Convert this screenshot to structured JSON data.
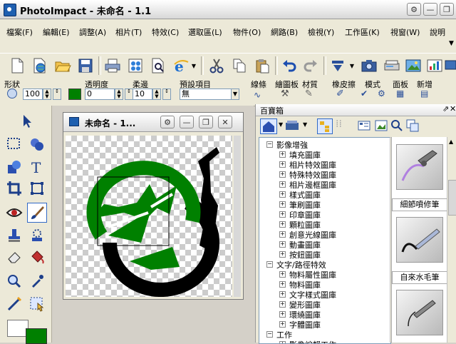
{
  "window": {
    "title": "PhotoImpact - 未命名 - 1.1"
  },
  "menu": [
    {
      "label": "檔案(F)"
    },
    {
      "label": "編輯(E)"
    },
    {
      "label": "調整(A)"
    },
    {
      "label": "相片(T)"
    },
    {
      "label": "特效(C)"
    },
    {
      "label": "選取區(L)"
    },
    {
      "label": "物件(O)"
    },
    {
      "label": "網路(B)"
    },
    {
      "label": "檢視(Y)"
    },
    {
      "label": "工作區(K)"
    },
    {
      "label": "視窗(W)"
    },
    {
      "label": "說明"
    }
  ],
  "attr": {
    "shape_label": "形狀",
    "size_value": "100",
    "opacity_label": "透明度",
    "opacity_value": "0",
    "soft_label": "柔邊",
    "soft_value": "10",
    "preset_label": "預設項目",
    "preset_value": "無",
    "line_label": "線條",
    "paint_label": "繪圖板",
    "material_label": "材質",
    "eraser_label": "橡皮擦",
    "mode_label": "模式",
    "panel_label": "面板",
    "new_label": "新增",
    "brush_color": "#008000"
  },
  "document": {
    "title": "未命名 - 1..."
  },
  "panel": {
    "title": "百寶箱",
    "tree": [
      {
        "label": "影像增強",
        "level": 1,
        "expanded": true
      },
      {
        "label": "填充圖庫",
        "level": 2
      },
      {
        "label": "相片特效圖庫",
        "level": 2
      },
      {
        "label": "特殊特效圖庫",
        "level": 2
      },
      {
        "label": "相片邊框圖庫",
        "level": 2
      },
      {
        "label": "樣式圖庫",
        "level": 2
      },
      {
        "label": "筆刷圖庫",
        "level": 2
      },
      {
        "label": "印章圖庫",
        "level": 2
      },
      {
        "label": "顆粒圖庫",
        "level": 2
      },
      {
        "label": "創意光線圖庫",
        "level": 2
      },
      {
        "label": "動畫圖庫",
        "level": 2
      },
      {
        "label": "按鈕圖庫",
        "level": 2
      },
      {
        "label": "文字/路徑特效",
        "level": 1,
        "expanded": true
      },
      {
        "label": "物料屬性圖庫",
        "level": 2
      },
      {
        "label": "物料圖庫",
        "level": 2
      },
      {
        "label": "文字樣式圖庫",
        "level": 2
      },
      {
        "label": "變形圖庫",
        "level": 2
      },
      {
        "label": "環繞圖庫",
        "level": 2
      },
      {
        "label": "字體圖庫",
        "level": 2
      },
      {
        "label": "工作",
        "level": 1,
        "expanded": true
      },
      {
        "label": "影像編輯工作",
        "level": 2
      }
    ],
    "gallery": [
      {
        "label": "細節噴修筆"
      },
      {
        "label": "自來水毛筆"
      }
    ]
  },
  "colors": {
    "foreground": "#ffffff",
    "background": "#008000",
    "accent": "#3169c6"
  }
}
